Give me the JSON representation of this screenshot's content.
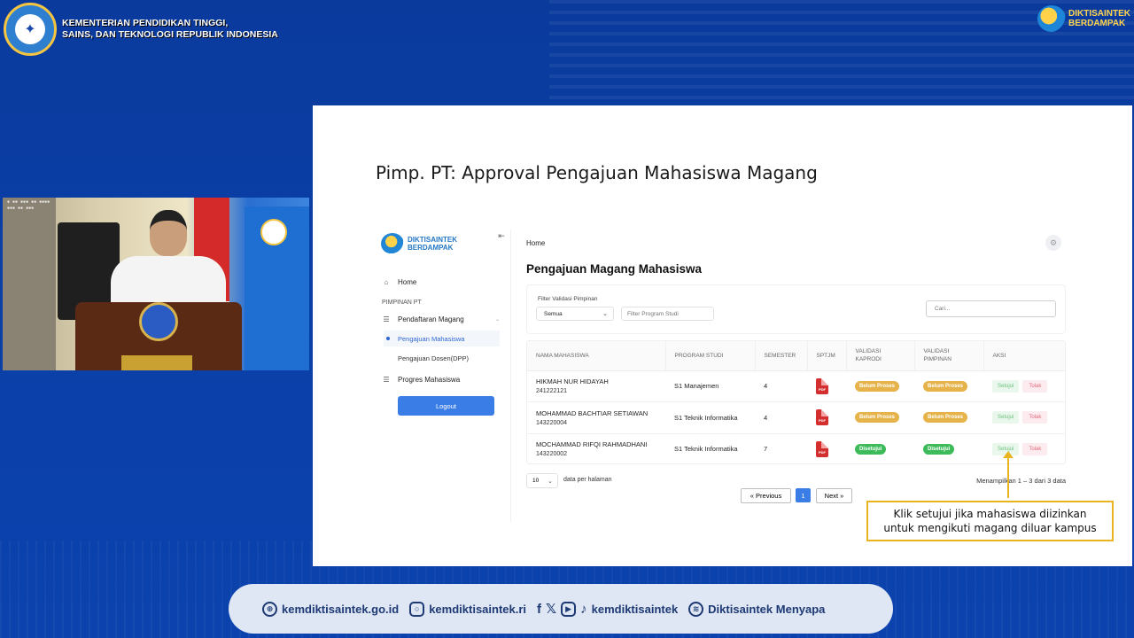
{
  "header": {
    "ministry_line1": "KEMENTERIAN PENDIDIKAN TINGGI,",
    "ministry_line2": "SAINS, DAN TEKNOLOGI REPUBLIK INDONESIA",
    "brand_line1": "DIKTISAINTEK",
    "brand_line2": "BERDAMPAK"
  },
  "slide": {
    "title": "Pimp. PT: Approval Pengajuan Mahasiswa Magang"
  },
  "app": {
    "logo_line1": "DIKTISAINTEK",
    "logo_line2": "BERDAMPAK",
    "sidebar": {
      "home": "Home",
      "section": "PIMPINAN PT",
      "pendaftaran": "Pendaftaran Magang",
      "sub_items": [
        "Pengajuan Mahasiswa",
        "Pengajuan Dosen(DPP)"
      ],
      "progres": "Progres Mahasiswa",
      "logout": "Logout"
    },
    "breadcrumb": "Home",
    "page_title": "Pengajuan Magang Mahasiswa",
    "filter": {
      "label": "Filter Validasi Pimpinan",
      "selected": "Semua",
      "prodi_placeholder": "Filter Program Studi",
      "search_placeholder": "Cari..."
    },
    "table": {
      "headers": [
        "NAMA MAHASISWA",
        "PROGRAM STUDI",
        "SEMESTER",
        "SPTJM",
        "VALIDASI KAPRODI",
        "VALIDASI PIMPINAN",
        "AKSI"
      ],
      "rows": [
        {
          "name": "HIKMAH NUR HIDAYAH",
          "nim": "241222121",
          "prodi": "S1 Manajemen",
          "semester": "4",
          "pdf": "PDF",
          "kaprodi": "Belum Proses",
          "pimpinan": "Belum Proses",
          "approve": "Setujui",
          "reject": "Tolak"
        },
        {
          "name": "MOHAMMAD BACHTIAR SETIAWAN",
          "nim": "143220004",
          "prodi": "S1 Teknik Informatika",
          "semester": "4",
          "pdf": "PDF",
          "kaprodi": "Belum Proses",
          "pimpinan": "Belum Proses",
          "approve": "Setujui",
          "reject": "Tolak"
        },
        {
          "name": "MOCHAMMAD RIFQI RAHMADHANI",
          "nim": "143220002",
          "prodi": "S1 Teknik Informatika",
          "semester": "7",
          "pdf": "PDF",
          "kaprodi": "Disetujui",
          "pimpinan": "Disetujui",
          "approve": "Setujui",
          "reject": "Tolak"
        }
      ]
    },
    "pagination": {
      "per_page": "10",
      "per_page_label": "data per halaman",
      "showing": "Menampilkan 1 – 3 dari 3 data",
      "prev": "« Previous",
      "current": "1",
      "next": "Next »"
    }
  },
  "callout": "Klik setujui jika mahasiswa diizinkan untuk mengikuti magang diluar kampus",
  "footer": {
    "website": "kemdiktisaintek.go.id",
    "instagram": "kemdiktisaintek.ri",
    "socials": "kemdiktisaintek",
    "spotify": "Diktisaintek Menyapa"
  },
  "colors": {
    "background": "#0b3fa8",
    "accent": "#3b7de6",
    "warning_badge": "#e5b34a",
    "success_badge": "#3dbb5a",
    "callout_border": "#e8b51f"
  },
  "icons": [
    "home-icon",
    "menu-icon",
    "gear-icon",
    "pdf-icon",
    "globe-icon",
    "instagram-icon",
    "facebook-icon",
    "x-icon",
    "youtube-icon",
    "tiktok-icon",
    "spotify-icon"
  ]
}
